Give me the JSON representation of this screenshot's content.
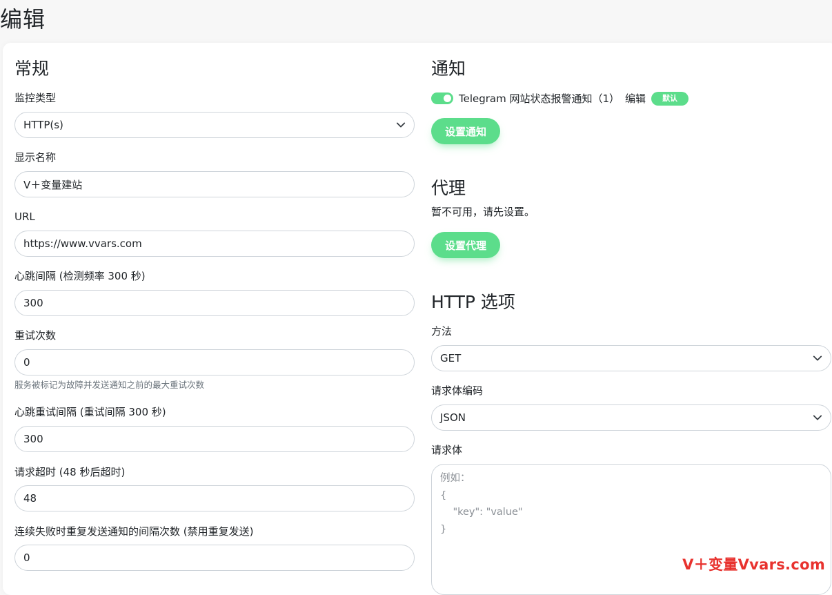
{
  "page": {
    "title": "编辑"
  },
  "general": {
    "heading": "常规",
    "monitor_type": {
      "label": "监控类型",
      "value": "HTTP(s)"
    },
    "display_name": {
      "label": "显示名称",
      "value": "V＋变量建站"
    },
    "url": {
      "label": "URL",
      "value": "https://www.vvars.com"
    },
    "heartbeat_interval": {
      "label": "心跳间隔 (检测频率 300 秒)",
      "value": "300"
    },
    "retries": {
      "label": "重试次数",
      "value": "0",
      "help": "服务被标记为故障并发送通知之前的最大重试次数"
    },
    "retry_interval": {
      "label": "心跳重试间隔 (重试间隔 300 秒)",
      "value": "300"
    },
    "request_timeout": {
      "label": "请求超时 (48 秒后超时)",
      "value": "48"
    },
    "resend_interval": {
      "label": "连续失败时重复发送通知的间隔次数 (禁用重复发送)",
      "value": "0"
    }
  },
  "notifications": {
    "heading": "通知",
    "item": {
      "name": "Telegram 网站状态报警通知（1）",
      "edit_label": "编辑",
      "default_badge": "默认",
      "enabled": true
    },
    "setup_button": "设置通知"
  },
  "proxy": {
    "heading": "代理",
    "unavailable_text": "暂不可用，请先设置。",
    "setup_button": "设置代理"
  },
  "http_options": {
    "heading": "HTTP 选项",
    "method": {
      "label": "方法",
      "value": "GET"
    },
    "body_encoding": {
      "label": "请求体编码",
      "value": "JSON"
    },
    "body": {
      "label": "请求体",
      "placeholder": "例如：\n{\n    \"key\": \"value\"\n}"
    }
  },
  "watermark": {
    "text": "V＋变量Vvars.com"
  },
  "colors": {
    "accent": "#5cdd8b",
    "watermark": "#e8322e"
  }
}
